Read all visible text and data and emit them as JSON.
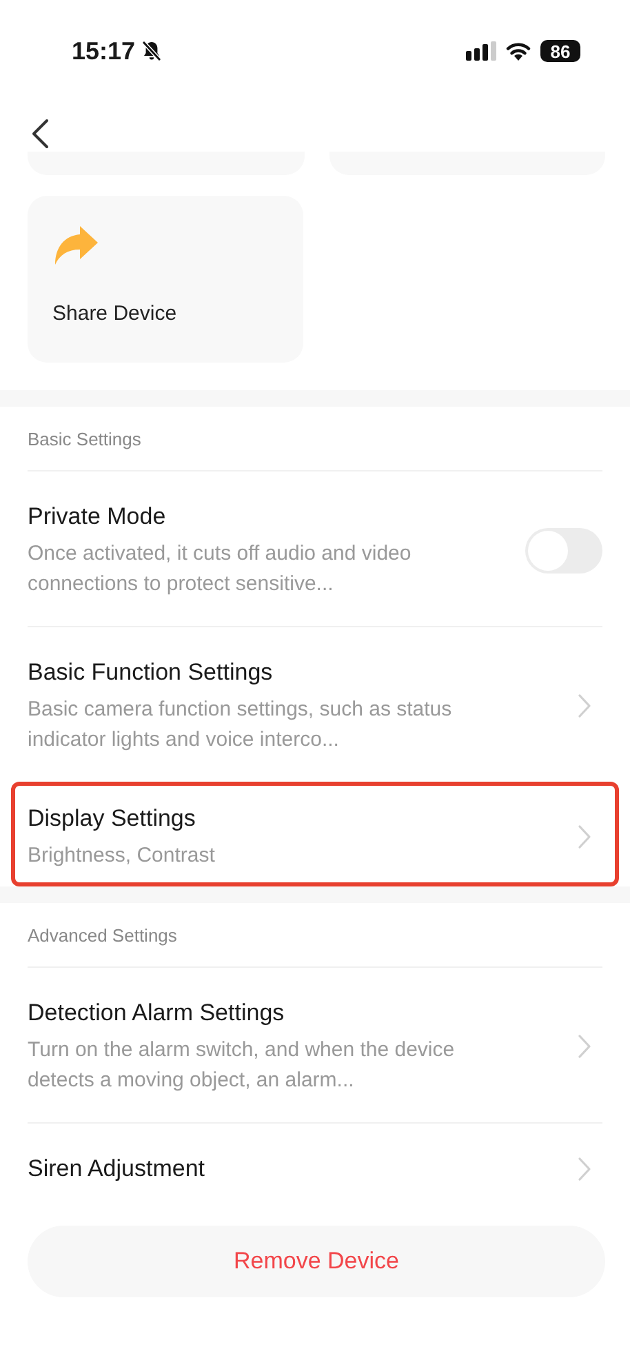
{
  "status_bar": {
    "time": "15:17",
    "silent": true,
    "battery": "86"
  },
  "quick_actions": [
    {
      "label": "Share Device"
    }
  ],
  "sections": [
    {
      "title": "Basic Settings",
      "items": [
        {
          "kind": "toggle",
          "title": "Private Mode",
          "description": "Once activated, it cuts off audio and video connections to protect sensitive...",
          "on": false,
          "highlighted": false
        },
        {
          "kind": "link",
          "title": "Basic Function Settings",
          "description": "Basic camera function settings, such as status indicator lights and voice interco...",
          "highlighted": false
        },
        {
          "kind": "link",
          "title": "Display Settings",
          "description": "Brightness, Contrast",
          "highlighted": true
        }
      ]
    },
    {
      "title": "Advanced Settings",
      "items": [
        {
          "kind": "link",
          "title": "Detection Alarm Settings",
          "description": "Turn on the alarm switch, and when the device detects a moving object, an alarm...",
          "highlighted": false
        },
        {
          "kind": "link",
          "title": "Siren Adjustment",
          "highlighted": false
        }
      ]
    }
  ],
  "remove_button": "Remove Device"
}
